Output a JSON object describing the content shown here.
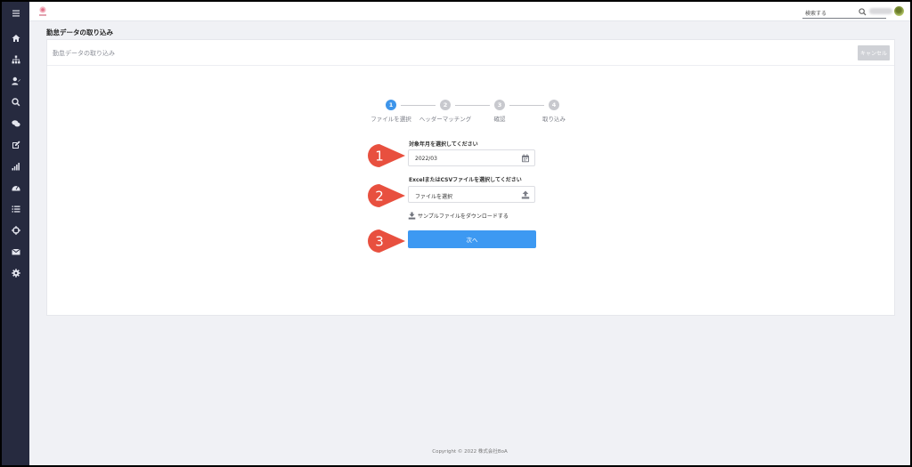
{
  "sidebar": {
    "items": [
      {
        "icon": "menu-icon"
      },
      {
        "icon": "home-icon"
      },
      {
        "icon": "org-chart-icon"
      },
      {
        "icon": "user-edit-icon"
      },
      {
        "icon": "search-icon"
      },
      {
        "icon": "chat-icon"
      },
      {
        "icon": "edit-icon"
      },
      {
        "icon": "bar-chart-icon"
      },
      {
        "icon": "dashboard-icon"
      },
      {
        "icon": "list-icon"
      },
      {
        "icon": "crosshair-icon"
      },
      {
        "icon": "mail-icon"
      },
      {
        "icon": "gear-icon"
      }
    ]
  },
  "header": {
    "search_placeholder": "検索する"
  },
  "page": {
    "title": "勤怠データの取り込み"
  },
  "card": {
    "title": "勤怠データの取り込み",
    "cancel_label": "キャンセル"
  },
  "steps": [
    {
      "number": "1",
      "label": "ファイルを選択",
      "active": true
    },
    {
      "number": "2",
      "label": "ヘッダーマッチング",
      "active": false
    },
    {
      "number": "3",
      "label": "確認",
      "active": false
    },
    {
      "number": "4",
      "label": "取り込み",
      "active": false
    }
  ],
  "form": {
    "month_label": "対象年月を選択してください",
    "month_value": "2022/03",
    "file_label": "ExcelまたはCSVファイルを選択してください",
    "file_placeholder": "ファイルを選択",
    "download_label": "サンプルファイルをダウンロードする",
    "next_label": "次へ"
  },
  "markers": [
    "1",
    "2",
    "3"
  ],
  "colors": {
    "accent": "#3d99f2",
    "marker": "#e8503f",
    "sidebar": "#262a3f"
  },
  "footer": {
    "copyright": "Copyright © 2022 株式会社BoA"
  }
}
